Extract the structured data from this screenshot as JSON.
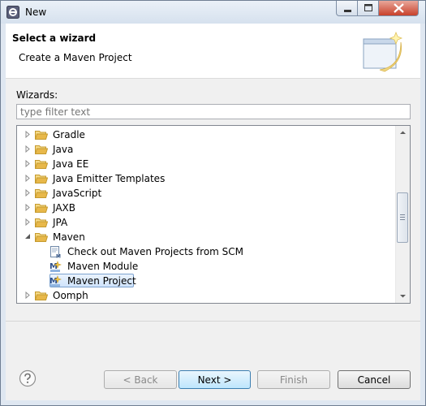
{
  "window": {
    "title": "New"
  },
  "banner": {
    "title": "Select a wizard",
    "description": "Create a Maven Project"
  },
  "wizards_label": "Wizards:",
  "filter": {
    "placeholder": "type filter text",
    "value": ""
  },
  "tree": {
    "items": [
      {
        "label": "Gradle",
        "type": "folder",
        "expanded": false
      },
      {
        "label": "Java",
        "type": "folder",
        "expanded": false
      },
      {
        "label": "Java EE",
        "type": "folder",
        "expanded": false
      },
      {
        "label": "Java Emitter Templates",
        "type": "folder",
        "expanded": false
      },
      {
        "label": "JavaScript",
        "type": "folder",
        "expanded": false
      },
      {
        "label": "JAXB",
        "type": "folder",
        "expanded": false
      },
      {
        "label": "JPA",
        "type": "folder",
        "expanded": false
      },
      {
        "label": "Maven",
        "type": "folder",
        "expanded": true
      },
      {
        "label": "Check out Maven Projects from SCM",
        "type": "wizard",
        "icon": "maven-checkout-icon"
      },
      {
        "label": "Maven Module",
        "type": "wizard",
        "icon": "maven-module-icon"
      },
      {
        "label": "Maven Project",
        "type": "wizard",
        "icon": "maven-project-icon",
        "selected": true
      },
      {
        "label": "Oomph",
        "type": "folder",
        "expanded": false
      }
    ]
  },
  "buttons": {
    "back": "< Back",
    "next": "Next >",
    "finish": "Finish",
    "cancel": "Cancel"
  },
  "colors": {
    "selection_border": "#7da2ce",
    "folder": "#e8b84a",
    "default_button": "#3c7fb1"
  }
}
